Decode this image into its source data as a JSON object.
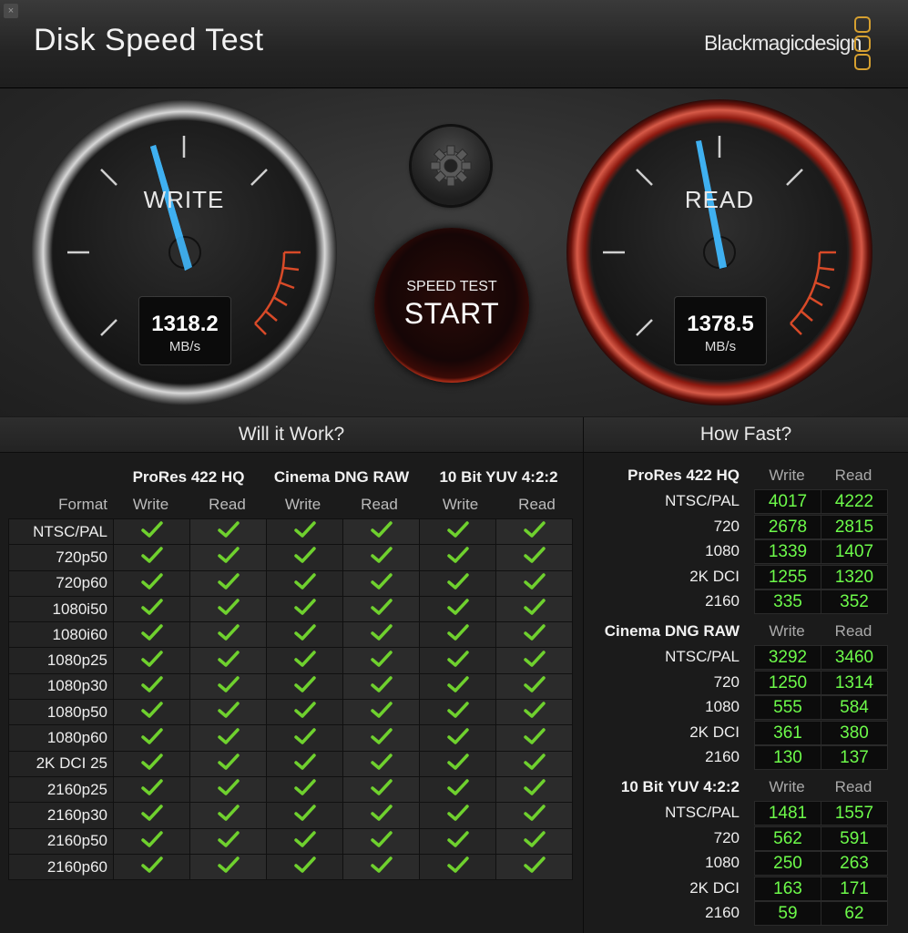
{
  "window": {
    "title": "Disk Speed Test",
    "close_glyph": "×"
  },
  "brand": {
    "name": "Blackmagicdesign"
  },
  "colors": {
    "accent_blue": "#3fb0f0",
    "check_green": "#6fd12e",
    "value_green": "#6dfb4a",
    "start_red": "#c0321a",
    "brand_gold": "#d6a030"
  },
  "gauges": {
    "write": {
      "label": "WRITE",
      "value": "1318.2",
      "unit": "MB/s"
    },
    "read": {
      "label": "READ",
      "value": "1378.5",
      "unit": "MB/s"
    }
  },
  "start_button": {
    "top_label": "SPEED TEST",
    "main_label": "START"
  },
  "settings_button": {
    "icon": "gear-icon"
  },
  "will_it_work": {
    "title": "Will it Work?",
    "format_header": "Format",
    "codecs": [
      {
        "name": "ProRes 422 HQ",
        "write": "Write",
        "read": "Read"
      },
      {
        "name": "Cinema DNG RAW",
        "write": "Write",
        "read": "Read"
      },
      {
        "name": "10 Bit YUV 4:2:2",
        "write": "Write",
        "read": "Read"
      }
    ],
    "formats": [
      "NTSC/PAL",
      "720p50",
      "720p60",
      "1080i50",
      "1080i60",
      "1080p25",
      "1080p30",
      "1080p50",
      "1080p60",
      "2K DCI 25",
      "2160p25",
      "2160p30",
      "2160p50",
      "2160p60"
    ],
    "all_supported": true
  },
  "how_fast": {
    "title": "How Fast?",
    "groups": [
      {
        "codec": "ProRes 422 HQ",
        "write_header": "Write",
        "read_header": "Read",
        "rows": [
          {
            "format": "NTSC/PAL",
            "write": "4017",
            "read": "4222"
          },
          {
            "format": "720",
            "write": "2678",
            "read": "2815"
          },
          {
            "format": "1080",
            "write": "1339",
            "read": "1407"
          },
          {
            "format": "2K DCI",
            "write": "1255",
            "read": "1320"
          },
          {
            "format": "2160",
            "write": "335",
            "read": "352"
          }
        ]
      },
      {
        "codec": "Cinema DNG RAW",
        "write_header": "Write",
        "read_header": "Read",
        "rows": [
          {
            "format": "NTSC/PAL",
            "write": "3292",
            "read": "3460"
          },
          {
            "format": "720",
            "write": "1250",
            "read": "1314"
          },
          {
            "format": "1080",
            "write": "555",
            "read": "584"
          },
          {
            "format": "2K DCI",
            "write": "361",
            "read": "380"
          },
          {
            "format": "2160",
            "write": "130",
            "read": "137"
          }
        ]
      },
      {
        "codec": "10 Bit YUV 4:2:2",
        "write_header": "Write",
        "read_header": "Read",
        "rows": [
          {
            "format": "NTSC/PAL",
            "write": "1481",
            "read": "1557"
          },
          {
            "format": "720",
            "write": "562",
            "read": "591"
          },
          {
            "format": "1080",
            "write": "250",
            "read": "263"
          },
          {
            "format": "2K DCI",
            "write": "163",
            "read": "171"
          },
          {
            "format": "2160",
            "write": "59",
            "read": "62"
          }
        ]
      }
    ]
  }
}
